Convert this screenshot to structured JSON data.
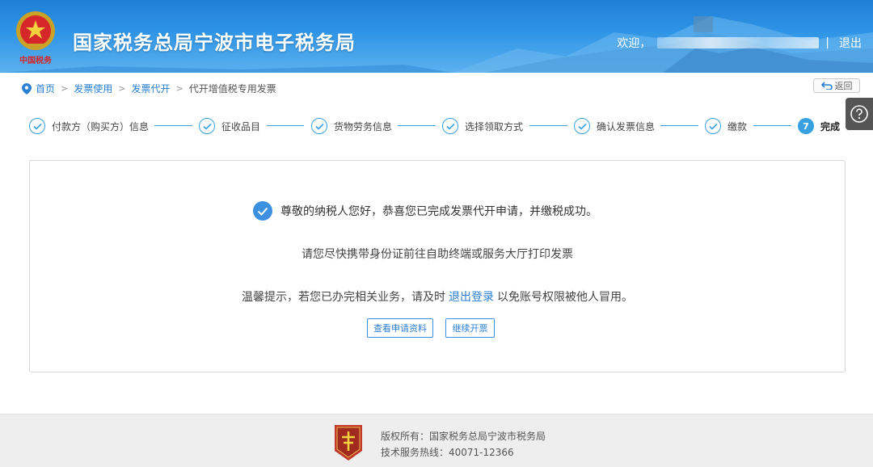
{
  "header": {
    "site_title": "国家税务总局宁波市电子税务局",
    "welcome": "欢迎，",
    "separator": "|",
    "logout": "退出"
  },
  "breadcrumb": {
    "items": [
      "首页",
      "发票使用",
      "发票代开"
    ],
    "current": "代开增值税专用发票",
    "arrow": ">"
  },
  "back_button": "返回",
  "steps": [
    {
      "label": "付款方（购买方）信息",
      "status": "done"
    },
    {
      "label": "征收品目",
      "status": "done"
    },
    {
      "label": "货物劳务信息",
      "status": "done"
    },
    {
      "label": "选择领取方式",
      "status": "done"
    },
    {
      "label": "确认发票信息",
      "status": "done"
    },
    {
      "label": "缴款",
      "status": "done"
    },
    {
      "label": "完成",
      "status": "active",
      "number": "7"
    }
  ],
  "result": {
    "success_message": "尊敬的纳税人您好，恭喜您已完成发票代开申请，并缴税成功。",
    "instruction": "请您尽快携带身份证前往自助终端或服务大厅打印发票",
    "tip_prefix": "温馨提示，若您已办完相关业务，请及时",
    "tip_link": "退出登录",
    "tip_suffix": "以免账号权限被他人冒用。",
    "view_button": "查看申请资料",
    "continue_button": "继续开票"
  },
  "footer": {
    "copyright": "版权所有：国家税务总局宁波市税务局",
    "hotline": "技术服务热线：40071-12366"
  },
  "colors": {
    "accent": "#39a0e0",
    "link": "#2a7fd4",
    "header_blue": "#2f95e6"
  }
}
